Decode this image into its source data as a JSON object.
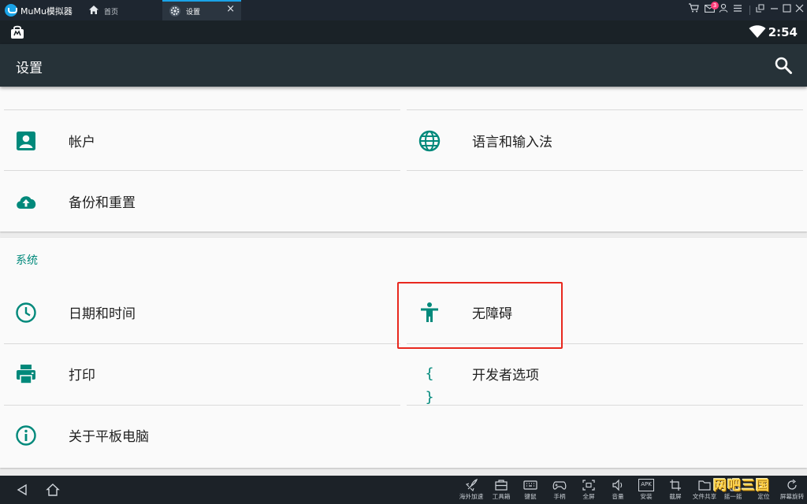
{
  "window": {
    "app_name": "MuMu模拟器",
    "tabs": [
      {
        "label": "首页"
      },
      {
        "label": "设置"
      }
    ],
    "notification_count": "3"
  },
  "status_bar": {
    "time": "2:54"
  },
  "action_bar": {
    "title": "设置"
  },
  "settings": {
    "personal_items": [
      {
        "label": "帐户",
        "icon": "account-box-icon"
      },
      {
        "label": "语言和输入法",
        "icon": "globe-icon"
      },
      {
        "label": "备份和重置",
        "icon": "cloud-upload-icon"
      }
    ],
    "system_header": "系统",
    "system_items": [
      {
        "label": "日期和时间",
        "icon": "clock-icon"
      },
      {
        "label": "无障碍",
        "icon": "accessibility-icon"
      },
      {
        "label": "打印",
        "icon": "printer-icon"
      },
      {
        "label": "开发者选项",
        "icon": "braces-icon",
        "icon_text": "{ }"
      },
      {
        "label": "关于平板电脑",
        "icon": "info-icon"
      }
    ]
  },
  "toolbar": [
    {
      "label": "海外加速",
      "icon": "rocket-icon"
    },
    {
      "label": "工具箱",
      "icon": "toolbox-icon"
    },
    {
      "label": "键鼠",
      "icon": "keyboard-icon"
    },
    {
      "label": "手柄",
      "icon": "gamepad-icon"
    },
    {
      "label": "全屏",
      "icon": "fullscreen-icon"
    },
    {
      "label": "音量",
      "icon": "volume-icon"
    },
    {
      "label": "安装",
      "icon": "apk-icon",
      "icon_text": "APK"
    },
    {
      "label": "截屏",
      "icon": "crop-icon"
    },
    {
      "label": "文件共享",
      "icon": "folder-icon"
    },
    {
      "label": "摇一摇",
      "icon": "shake-icon"
    },
    {
      "label": "定位",
      "icon": "location-icon"
    },
    {
      "label": "屏幕旋转",
      "icon": "rotate-icon"
    }
  ],
  "watermark": "网吧三国",
  "colors": {
    "accent": "#00897b",
    "action_bar": "#263238",
    "title_bar": "#1e2630",
    "highlight_border": "#e8281e"
  }
}
